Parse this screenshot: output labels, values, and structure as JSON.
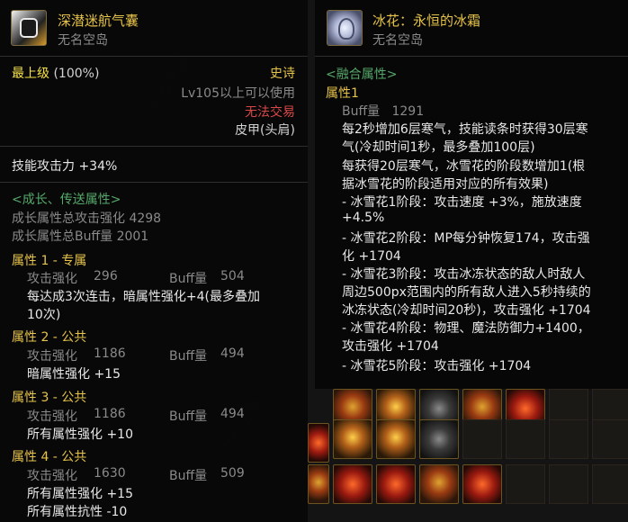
{
  "watermark": "无名空岛",
  "left": {
    "item_name": "深潜迷航气囊",
    "server": "无名空岛",
    "grade_label": "最上级",
    "grade_pct": "(100%)",
    "rarity": "史诗",
    "level_req": "Lv105以上可以使用",
    "trade": "无法交易",
    "slot": "皮甲(头肩)",
    "skill_atk": "技能攻击力 +34%",
    "growth_title": "<成长、传送属性>",
    "growth_total_atk": "成长属性总攻击强化 4298",
    "growth_total_buff": "成长属性总Buff量 2001",
    "attrs": [
      {
        "title": "属性 1 - 专属",
        "atk_label": "攻击强化",
        "atk": "296",
        "buff_label": "Buff量",
        "buff": "504",
        "desc1": "每达成3次连击，暗属性强化+4(最多叠加",
        "desc2": "10次)"
      },
      {
        "title": "属性 2 - 公共",
        "atk_label": "攻击强化",
        "atk": "1186",
        "buff_label": "Buff量",
        "buff": "494",
        "desc1": "暗属性强化 +15"
      },
      {
        "title": "属性 3 - 公共",
        "atk_label": "攻击强化",
        "atk": "1186",
        "buff_label": "Buff量",
        "buff": "494",
        "desc1": "所有属性强化 +10"
      },
      {
        "title": "属性 4 - 公共",
        "atk_label": "攻击强化",
        "atk": "1630",
        "buff_label": "Buff量",
        "buff": "509",
        "desc1": "所有属性强化 +15",
        "desc2": "所有属性抗性 -10"
      }
    ]
  },
  "right": {
    "item_name": "冰花：永恒的冰霜",
    "server": "无名空岛",
    "fusion_title": "<融合属性>",
    "attr_title": "属性1",
    "buff_line": "Buff量   1291",
    "lines": [
      "每2秒增加6层寒气，技能读条时获得30层寒",
      "气(冷却时间1秒，最多叠加100层)",
      "每获得20层寒气，冰雪花的阶段数增加1(根",
      "据冰雪花的阶段适用对应的所有效果)",
      "- 冰雪花1阶段：攻击速度 +3%，施放速度",
      "+4.5%",
      "- 冰雪花2阶段：MP每分钟恢复174，攻击强",
      "化 +1704",
      "- 冰雪花3阶段：攻击冰冻状态的敌人时敌人",
      "周边500px范围内的所有敌人进入5秒持续的",
      "冰冻状态(冷却时间20秒)，攻击强化 +1704",
      "- 冰雪花4阶段：物理、魔法防御力+1400，",
      "攻击强化 +1704",
      "- 冰雪花5阶段：攻击强化 +1704"
    ]
  },
  "colors": {
    "gold": "#e6c34a",
    "rarity_yellow": "#f5e14a",
    "green": "#55a86a",
    "red": "#d94848",
    "gray": "#8a8a8a"
  }
}
